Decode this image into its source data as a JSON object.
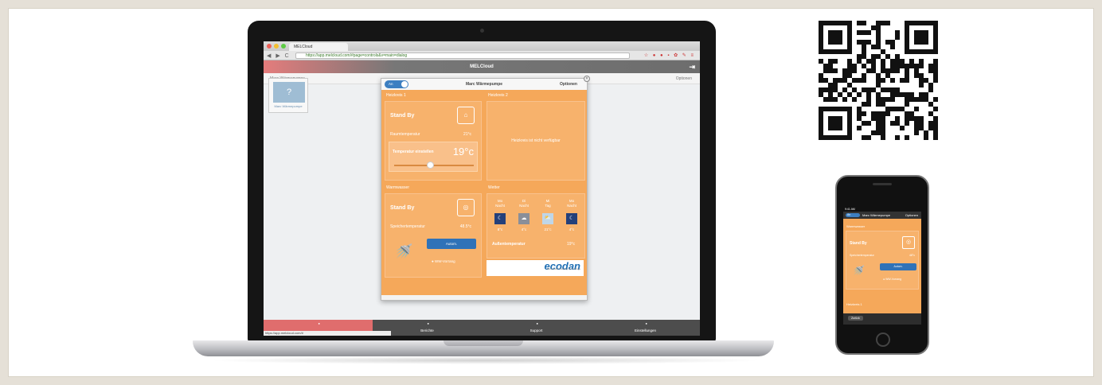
{
  "browser": {
    "tab_title": "MELCloud",
    "url": "https://app.melcloud.com/#page=controls&v=main=dialog",
    "nav_glyphs": "◀ ▶ C",
    "ext_glyphs": "☆ ● ● ▪ ✿ ✎ ≡"
  },
  "app": {
    "title": "MELCloud",
    "device_name": "Marc Wärmepumpe",
    "options_label": "Optionen",
    "tile_label": "Marc Wärmepumpe",
    "tile_glyph": "?",
    "bottom_nav": [
      "",
      "Berichte",
      "Support",
      "Einstellungen"
    ],
    "status_url": "https://app.melcloud.com/#"
  },
  "dialog": {
    "toggle_label": "An",
    "title": "Marc Wärmepumpe",
    "options_label": "Optionen",
    "heizkreis1": {
      "header": "Heizkreis 1",
      "state": "Stand By",
      "room_temp_label": "Raumtemperatur",
      "room_temp_value": "21°c",
      "set_temp_label": "Temperatur einstellen",
      "set_temp_value": "19°c",
      "slider_fraction": 0.45
    },
    "heizkreis2": {
      "header": "Heizkreis 2",
      "message": "Heizkreis ist nicht verfügbar"
    },
    "warmwasser": {
      "header": "Warmwasser",
      "state": "Stand By",
      "tank_temp_label": "Speichertemperatur",
      "tank_temp_value": "48.5°c",
      "button_auto": "Autom.",
      "button_ww": "WW-Vorrang"
    },
    "wetter": {
      "header": "Wetter",
      "days": [
        {
          "day": "Mo",
          "part": "Nacht",
          "icon": "☾",
          "temp": "8°c"
        },
        {
          "day": "Di",
          "part": "Nacht",
          "icon": "☁",
          "temp": "4°c"
        },
        {
          "day": "Mi",
          "part": "Tag",
          "icon": "⛅",
          "temp": "21°c"
        },
        {
          "day": "Mo",
          "part": "Nacht",
          "icon": "☾",
          "temp": "4°c"
        }
      ],
      "outdoor_label": "Außentemperatur",
      "outdoor_value": "19°c"
    },
    "brand": "ecodan",
    "brand_sub": "Renewable Heating Technology"
  },
  "phone": {
    "status": "9:41 AM",
    "toggle_label": "An",
    "title": "Marc Wärmepumpe",
    "options_label": "Optionen",
    "section": "Warmwasser",
    "state": "Stand By",
    "tank_temp_label": "Speichertemperatur",
    "tank_temp_value": "48°c",
    "button_auto": "Autom.",
    "button_ww": "WW-Vorrang",
    "section2": "Heizkreis 1",
    "back_label": "Zurück"
  },
  "colors": {
    "accent_orange": "#f5a85a",
    "accent_blue": "#2f72b8",
    "accent_red": "#e06d6d"
  }
}
